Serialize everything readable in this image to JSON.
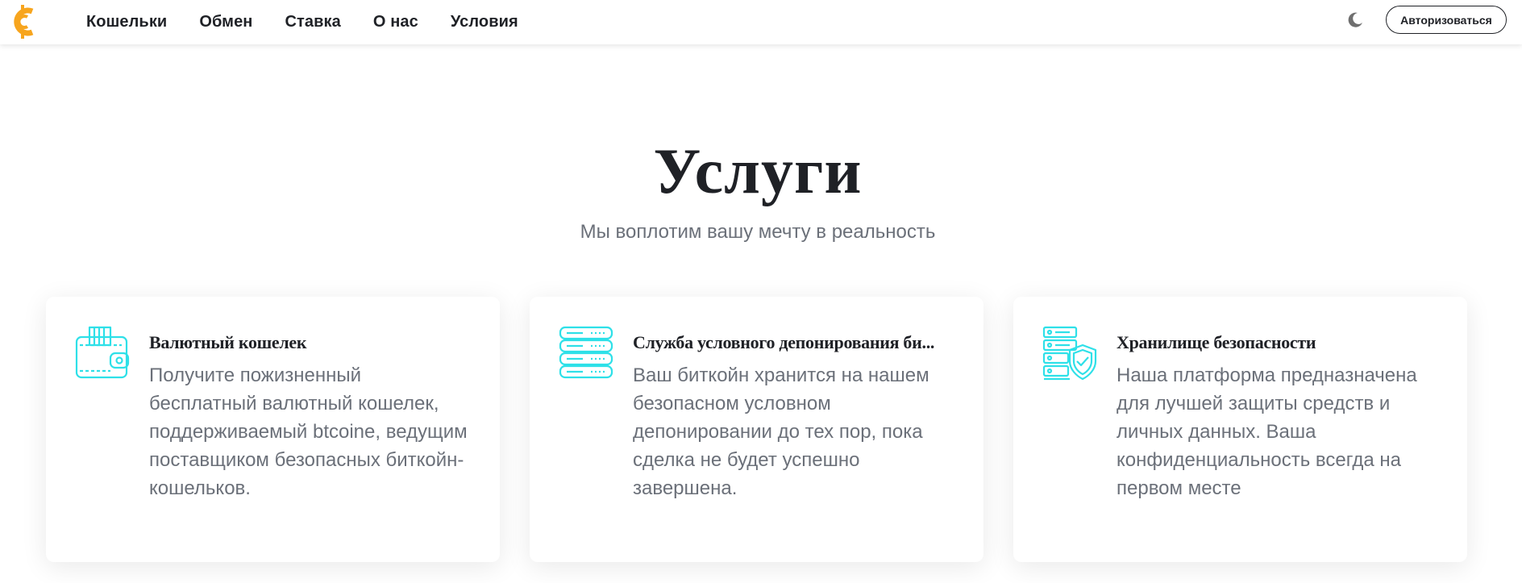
{
  "nav": {
    "items": [
      "Кошельки",
      "Обмен",
      "Ставка",
      "О нас",
      "Условия"
    ],
    "login_label": "Авторизоваться"
  },
  "hero": {
    "title": "Услуги",
    "subtitle": "Мы воплотим вашу мечту в реальность"
  },
  "cards": [
    {
      "icon": "wallet-icon",
      "title": "Валютный кошелек",
      "description": "Получите пожизненный бесплатный валютный кошелек, поддерживаемый btcoine, ведущим поставщиком безопасных биткойн-кошельков."
    },
    {
      "icon": "server-icon",
      "title": "Служба условного депонирования би...",
      "description": "Ваш биткойн хранится на нашем безопасном условном депонировании до тех пор, пока сделка не будет успешно завершена."
    },
    {
      "icon": "server-shield-icon",
      "title": "Хранилище безопасности",
      "description": "Наша платформа предназначена для лучшей защиты средств и личных данных. Ваша конфиденциальность всегда на первом месте"
    }
  ],
  "colors": {
    "logo": "#f7a51e",
    "icon_accent": "#2ee0e8",
    "text_dark": "#1f2126",
    "text_muted": "#6b7079"
  }
}
